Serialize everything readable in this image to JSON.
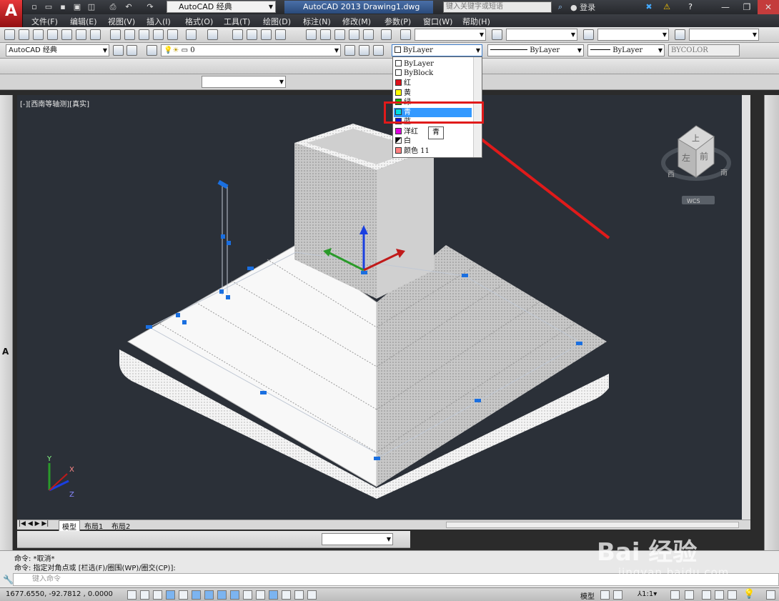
{
  "app": {
    "logo": "A",
    "workspace": "AutoCAD 经典",
    "title": "AutoCAD 2013    Drawing1.dwg",
    "search_placeholder": "键入关键字或短语",
    "login": "登录",
    "help": "?"
  },
  "menus": [
    "文件(F)",
    "编辑(E)",
    "视图(V)",
    "插入(I)",
    "格式(O)",
    "工具(T)",
    "绘图(D)",
    "标注(N)",
    "修改(M)",
    "参数(P)",
    "窗口(W)",
    "帮助(H)"
  ],
  "toolbar": {
    "workspace_combo": "AutoCAD 经典",
    "layer_combo": "0",
    "color_combo": "ByLayer",
    "linetype_combo": "ByLayer",
    "lineweight_combo": "ByLayer",
    "plotstyle_combo": "BYCOLOR"
  },
  "color_dropdown": {
    "items": [
      {
        "label": "ByLayer",
        "color": "#ffffff"
      },
      {
        "label": "ByBlock",
        "color": "#ffffff"
      },
      {
        "label": "红",
        "color": "#e0101a"
      },
      {
        "label": "黄",
        "color": "#ffff00"
      },
      {
        "label": "绿",
        "color": "#00c000"
      },
      {
        "label": "青",
        "color": "#00e0e0"
      },
      {
        "label": "蓝",
        "color": "#1010e0"
      },
      {
        "label": "洋红",
        "color": "#e000e0"
      },
      {
        "label": "白",
        "color": "#ffffff"
      },
      {
        "label": "颜色 11",
        "color": "#ff8080"
      }
    ],
    "tooltip": "青"
  },
  "viewport": {
    "label": "[-][西南等轴测][真实]",
    "viewcube": {
      "top": "上",
      "left": "左",
      "front": "前",
      "compass_w": "西",
      "compass_s": "南",
      "wcs": "WCS"
    },
    "ucs": {
      "x": "X",
      "y": "Y",
      "z": "Z"
    }
  },
  "tabs": [
    "模型",
    "布局1",
    "布局2"
  ],
  "command": {
    "line1": "命令: *取消*",
    "line2": "命令: 指定对角点或 [栏选(F)/圈围(WP)/圈交(CP)]:",
    "input_placeholder": "键入命令"
  },
  "status": {
    "coords": "1677.6550, -92.7812 , 0.0000",
    "model": "模型",
    "scale": "1:1"
  },
  "watermark": {
    "brand": "Bai 经验",
    "url": "jingyan.baidu.com"
  }
}
